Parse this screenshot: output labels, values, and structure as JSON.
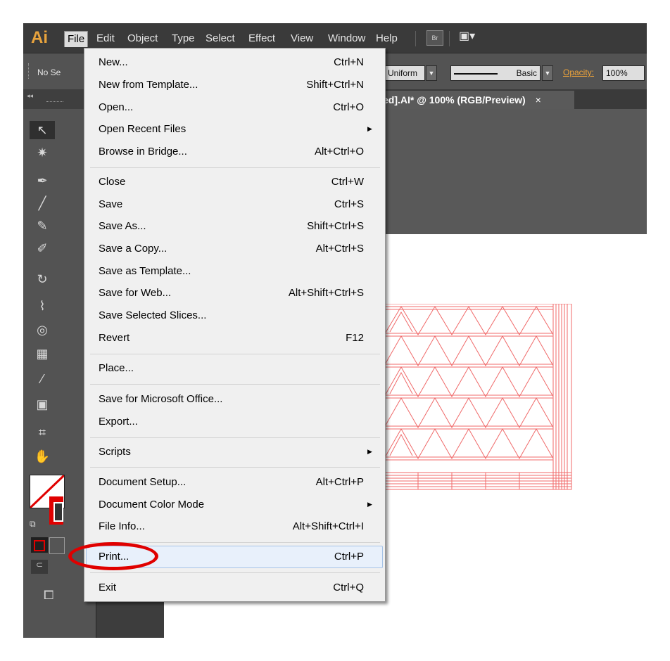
{
  "app": {
    "logo": "Ai"
  },
  "menubar": {
    "items": [
      "File",
      "Edit",
      "Object",
      "Type",
      "Select",
      "Effect",
      "View",
      "Window",
      "Help"
    ],
    "bridge_label": "Br",
    "workspace_icon": "▣▾"
  },
  "control_bar": {
    "selection_label": "No Se",
    "stroke_profile": "Uniform",
    "brush": "Basic",
    "opacity_label": "Opacity:",
    "opacity_value": "100%",
    "collapse_glyph": "◂◂"
  },
  "document_tab": {
    "title": "ed].AI* @ 100% (RGB/Preview)",
    "close": "×"
  },
  "file_menu": {
    "items": [
      {
        "label": "New...",
        "shortcut": "Ctrl+N"
      },
      {
        "label": "New from Template...",
        "shortcut": "Shift+Ctrl+N"
      },
      {
        "label": "Open...",
        "shortcut": "Ctrl+O"
      },
      {
        "label": "Open Recent Files",
        "shortcut": "",
        "submenu": true
      },
      {
        "label": "Browse in Bridge...",
        "shortcut": "Alt+Ctrl+O"
      },
      {
        "label": "Close",
        "shortcut": "Ctrl+W"
      },
      {
        "label": "Save",
        "shortcut": "Ctrl+S"
      },
      {
        "label": "Save As...",
        "shortcut": "Shift+Ctrl+S"
      },
      {
        "label": "Save a Copy...",
        "shortcut": "Alt+Ctrl+S"
      },
      {
        "label": "Save as Template...",
        "shortcut": ""
      },
      {
        "label": "Save for Web...",
        "shortcut": "Alt+Shift+Ctrl+S"
      },
      {
        "label": "Save Selected Slices...",
        "shortcut": ""
      },
      {
        "label": "Revert",
        "shortcut": "F12"
      },
      {
        "label": "Place...",
        "shortcut": ""
      },
      {
        "label": "Save for Microsoft Office...",
        "shortcut": ""
      },
      {
        "label": "Export...",
        "shortcut": ""
      },
      {
        "label": "Scripts",
        "shortcut": "",
        "submenu": true
      },
      {
        "label": "Document Setup...",
        "shortcut": "Alt+Ctrl+P"
      },
      {
        "label": "Document Color Mode",
        "shortcut": "",
        "submenu": true
      },
      {
        "label": "File Info...",
        "shortcut": "Alt+Shift+Ctrl+I"
      },
      {
        "label": "Print...",
        "shortcut": "Ctrl+P",
        "highlighted": true
      },
      {
        "label": "Exit",
        "shortcut": "Ctrl+Q"
      }
    ],
    "submenu_arrow": "▶"
  },
  "colors": {
    "menubar_bg": "#3a3a3a",
    "panel_bg": "#535353",
    "logo_orange": "#e8a33d",
    "artwork_red": "#f06a6a",
    "highlight_circle": "#e00000"
  }
}
